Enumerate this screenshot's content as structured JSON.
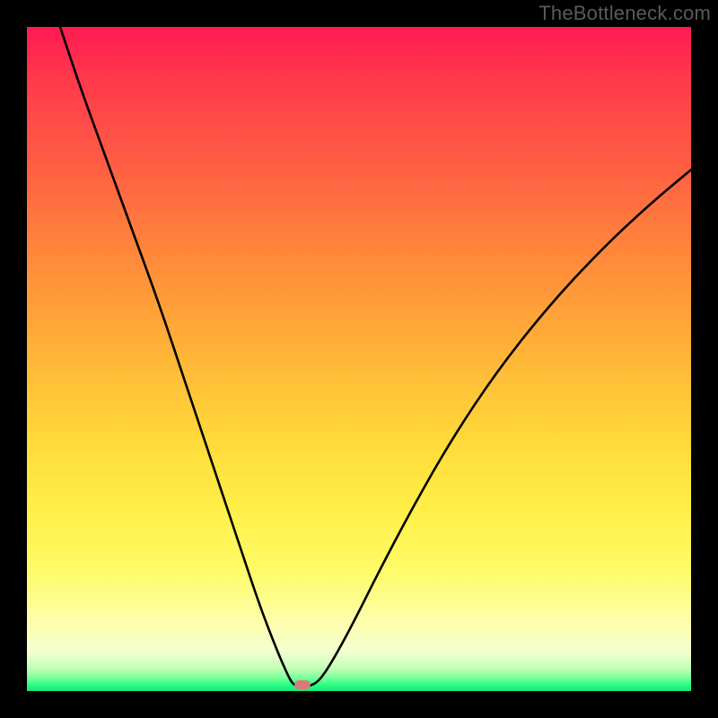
{
  "watermark": "TheBottleneck.com",
  "chart_data": {
    "type": "line",
    "title": "",
    "xlabel": "",
    "ylabel": "",
    "xlim_pct": [
      0,
      100
    ],
    "ylim_pct": [
      0,
      100
    ],
    "marker": {
      "x_pct": 41.5,
      "y_pct": 99
    },
    "series": [
      {
        "name": "bottleneck-curve",
        "points_pct": [
          {
            "x": 5.0,
            "y": 0.0
          },
          {
            "x": 8.0,
            "y": 9.0
          },
          {
            "x": 12.0,
            "y": 20.0
          },
          {
            "x": 16.0,
            "y": 31.0
          },
          {
            "x": 20.0,
            "y": 42.0
          },
          {
            "x": 24.0,
            "y": 54.0
          },
          {
            "x": 28.0,
            "y": 66.0
          },
          {
            "x": 32.0,
            "y": 78.0
          },
          {
            "x": 35.0,
            "y": 87.0
          },
          {
            "x": 37.5,
            "y": 93.5
          },
          {
            "x": 39.0,
            "y": 97.0
          },
          {
            "x": 40.0,
            "y": 99.0
          },
          {
            "x": 41.0,
            "y": 99.3
          },
          {
            "x": 42.5,
            "y": 99.3
          },
          {
            "x": 44.0,
            "y": 98.5
          },
          {
            "x": 46.0,
            "y": 95.5
          },
          {
            "x": 49.0,
            "y": 90.0
          },
          {
            "x": 53.0,
            "y": 82.0
          },
          {
            "x": 58.0,
            "y": 72.5
          },
          {
            "x": 64.0,
            "y": 62.0
          },
          {
            "x": 71.0,
            "y": 51.5
          },
          {
            "x": 79.0,
            "y": 41.5
          },
          {
            "x": 87.0,
            "y": 33.0
          },
          {
            "x": 94.0,
            "y": 26.5
          },
          {
            "x": 100.0,
            "y": 21.5
          }
        ]
      }
    ],
    "background_gradient_stops": [
      {
        "pct": 0,
        "color": "#ff1a52"
      },
      {
        "pct": 8,
        "color": "#ff3a4c"
      },
      {
        "pct": 20,
        "color": "#ff5b44"
      },
      {
        "pct": 35,
        "color": "#ff8a3a"
      },
      {
        "pct": 50,
        "color": "#ffb637"
      },
      {
        "pct": 62,
        "color": "#ffd93a"
      },
      {
        "pct": 72,
        "color": "#ffee46"
      },
      {
        "pct": 82,
        "color": "#fffb68"
      },
      {
        "pct": 90,
        "color": "#fdffaf"
      },
      {
        "pct": 94,
        "color": "#f3ffd0"
      },
      {
        "pct": 96.5,
        "color": "#c6ffb8"
      },
      {
        "pct": 98,
        "color": "#7bff9a"
      },
      {
        "pct": 99,
        "color": "#2eff87"
      },
      {
        "pct": 100,
        "color": "#17e57a"
      }
    ],
    "marker_color": "#d97a7a",
    "curve_color": "#000000"
  }
}
